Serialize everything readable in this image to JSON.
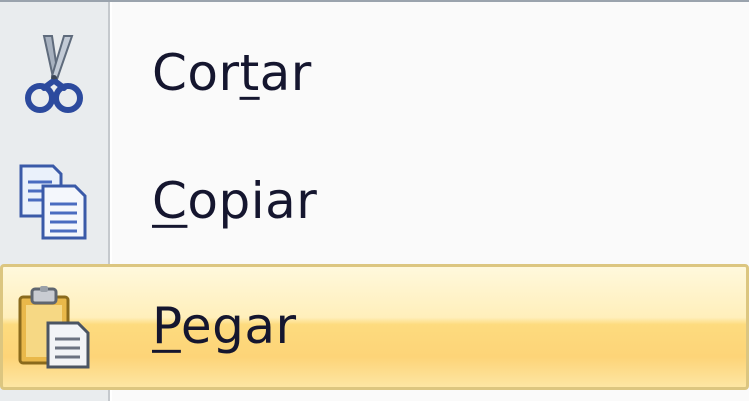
{
  "context_menu": {
    "items": [
      {
        "label_pre": "Cor",
        "label_key": "t",
        "label_post": "ar",
        "icon": "scissors-icon",
        "highlighted": false
      },
      {
        "label_pre": "",
        "label_key": "C",
        "label_post": "opiar",
        "icon": "copy-documents-icon",
        "highlighted": false
      },
      {
        "label_pre": "",
        "label_key": "P",
        "label_post": "egar",
        "icon": "clipboard-paste-icon",
        "highlighted": true
      }
    ],
    "colors": {
      "gutter": "#e9ecee",
      "background": "#fafafa",
      "text": "#15162f",
      "highlight_border": "#dcc680",
      "highlight_fill": "#fddb7e"
    }
  }
}
